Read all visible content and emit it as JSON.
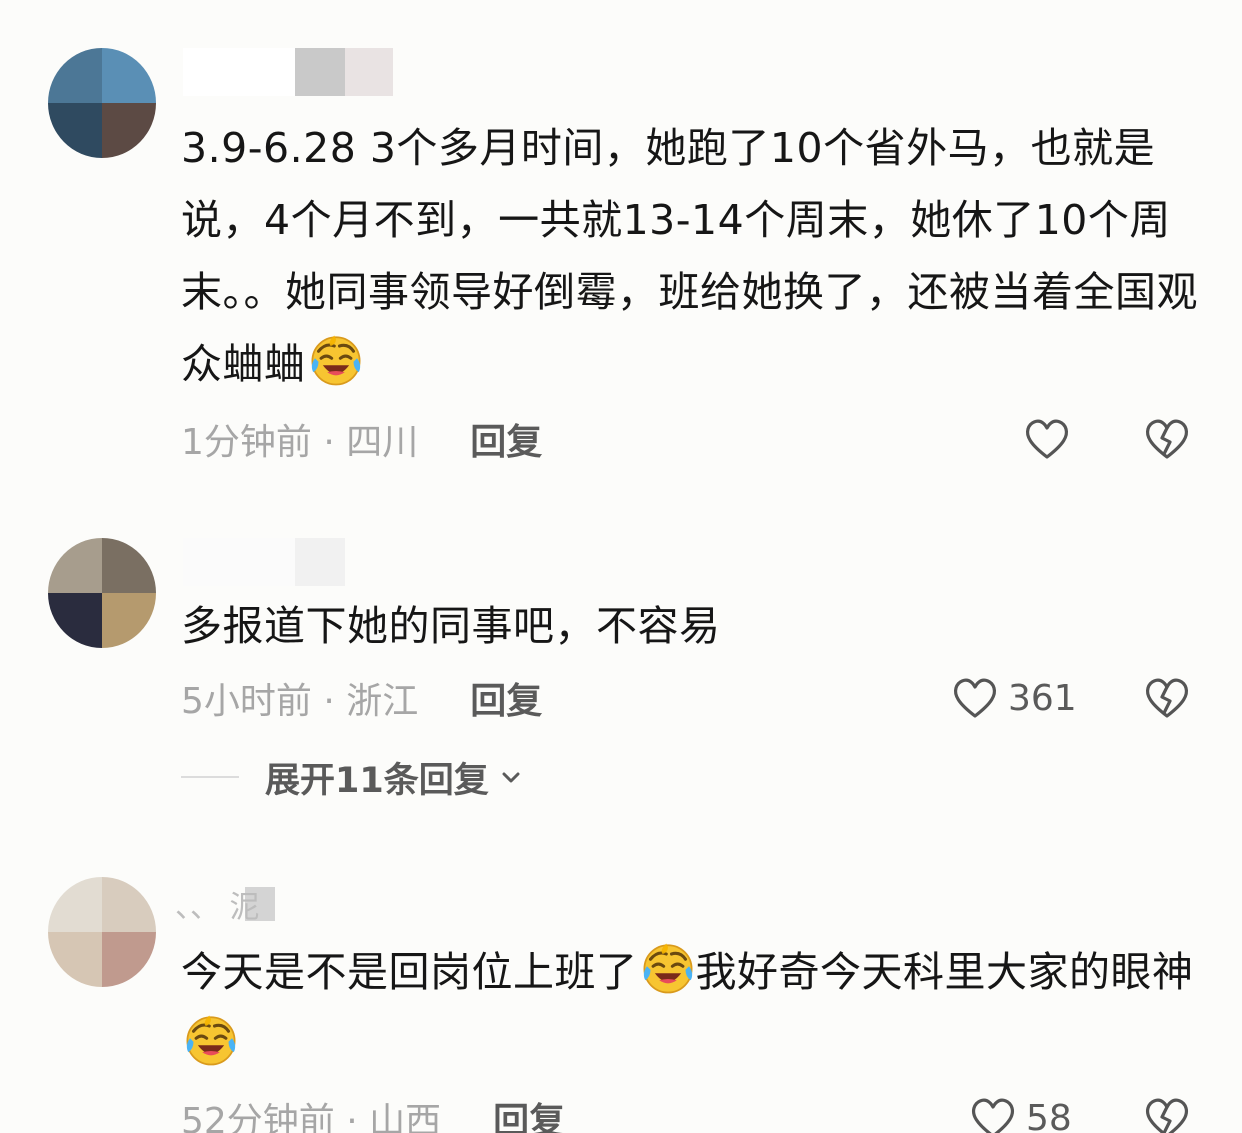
{
  "comments": [
    {
      "username": "",
      "text": "3.9-6.28 3个多月时间，她跑了10个省外马，也就是说，4个月不到，一共就13-14个周末，她休了10个周末。。她同事领导好倒霉，班给她换了，还被当着全国观众蛐蛐",
      "emoji": "rofl-emoji",
      "time_location": "1分钟前 · 四川",
      "reply_label": "回复",
      "likes": ""
    },
    {
      "username": "",
      "text": "多报道下她的同事吧，不容易",
      "time_location": "5小时前 · 浙江",
      "reply_label": "回复",
      "likes": "361",
      "expand_label": "展开11条回复"
    },
    {
      "username": "、、  泥",
      "text_part1": "今天是不是回岗位上班了",
      "text_part2": "我好奇今天科里大家的眼神",
      "emoji": "rofl-emoji",
      "time_location": "52分钟前 · 山西",
      "reply_label": "回复",
      "likes": "58"
    }
  ],
  "icons": {
    "like": "heart-outline-icon",
    "dislike": "broken-heart-icon",
    "expand": "chevron-down-icon"
  },
  "colors": {
    "background": "#fcfcfa",
    "text": "#161616",
    "meta": "#a6a6a6",
    "action": "#5a5a5a"
  }
}
